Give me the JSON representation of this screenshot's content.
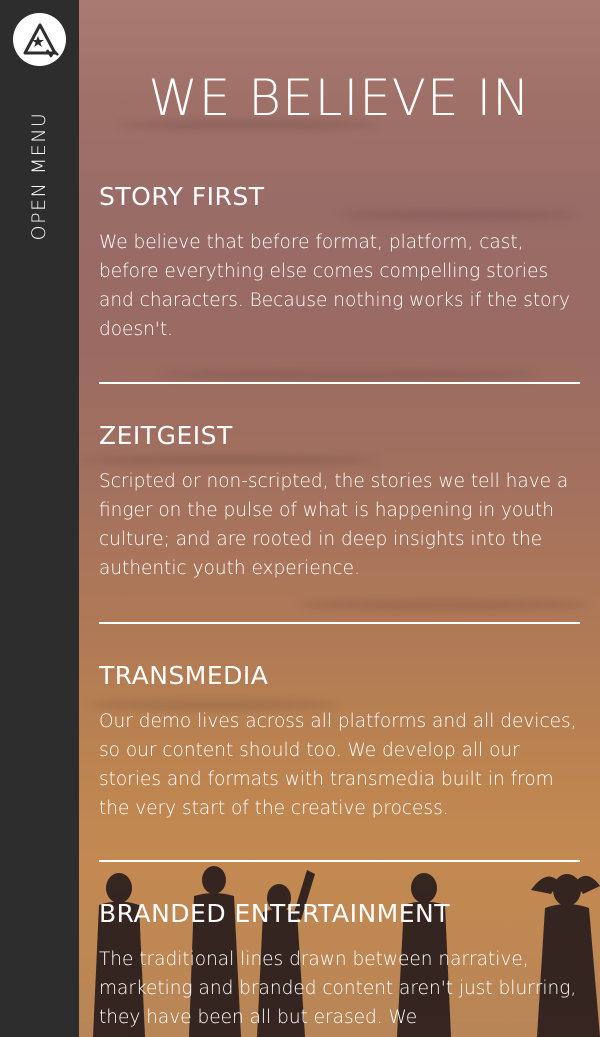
{
  "sidebar": {
    "open_menu_label": "OPEN MENU",
    "logo_icon": "mountain-star-logo"
  },
  "main": {
    "title": "WE BELIEVE IN",
    "sections": [
      {
        "heading": "STORY FIRST",
        "body": "We believe that before format, platform, cast, before everything else comes compelling stories and characters. Because nothing works if the story doesn't."
      },
      {
        "heading": "ZEITGEIST",
        "body": "Scripted or non-scripted, the stories we tell have a finger on the pulse of what is happening in youth culture; and are rooted in deep insights into the authentic youth experience."
      },
      {
        "heading": "TRANSMEDIA",
        "body": "Our demo lives across all platforms and all devices, so our content should too. We develop all our stories and formats with transmedia built in from the very start of the creative process."
      },
      {
        "heading": "BRANDED ENTERTAINMENT",
        "body": "The traditional lines drawn between narrative, marketing and branded content aren't just blurring, they have been all but erased. We"
      }
    ]
  },
  "colors": {
    "rail": "#2d2d2d",
    "text": "#ffffff",
    "background_top": "#a97b70",
    "background_bottom": "#c7905e"
  }
}
